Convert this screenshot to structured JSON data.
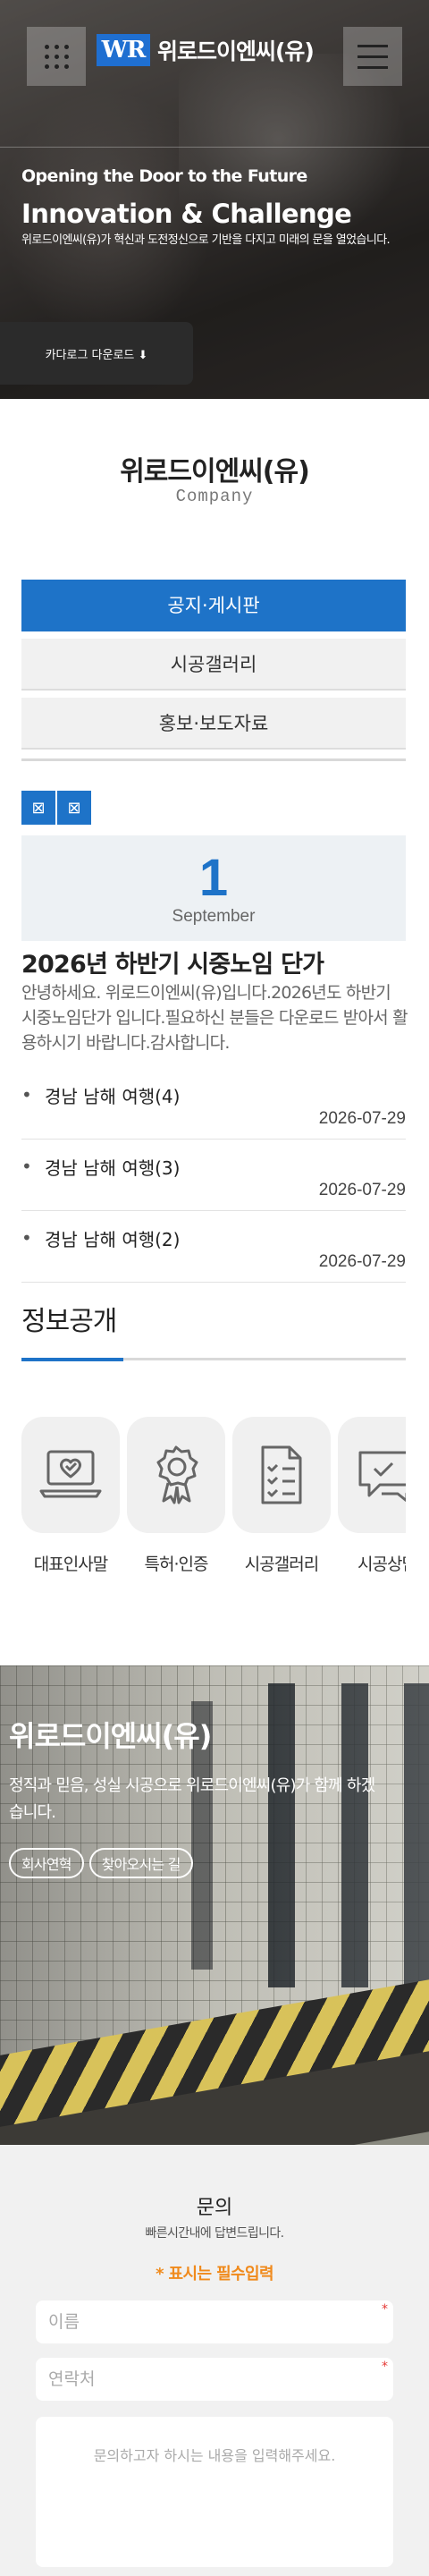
{
  "header": {
    "logo_mark": "WR",
    "logo_text": "위로드이엔씨(유)",
    "grid_icon": "grid-dots-icon",
    "menu_icon": "hamburger-menu-icon"
  },
  "hero": {
    "subtitle": "Opening the Door to the Future",
    "title": "Innovation & Challenge",
    "description": "위로드이엔씨(유)가 혁신과 도전정신으로 기반을 다지고 미래의 문을 열었습니다.",
    "catalog_button": "카다로그 다운로드 ⬇"
  },
  "company": {
    "title": "위로드이엔씨(유)",
    "subtitle": "Company"
  },
  "tabs": [
    {
      "label": "공지·게시판",
      "active": true
    },
    {
      "label": "시공갤러리",
      "active": false
    },
    {
      "label": "홍보·보도자료",
      "active": false
    }
  ],
  "pager": {
    "prev": "⊠",
    "next": "⊠"
  },
  "featured_post": {
    "day": "1",
    "month": "September",
    "title": "2026년 하반기 시중노임 단가",
    "body": "안녕하세요. 위로드이엔씨(유)입니다.2026년도 하반기 시중노임단가 입니다.필요하신 분들은 다운로드 받아서 활용하시기 바랍니다.감사합니다."
  },
  "news": [
    {
      "bullet": "•",
      "title": "경남 남해 여행(4)",
      "date": "2026-07-29"
    },
    {
      "bullet": "•",
      "title": "경남 남해 여행(3)",
      "date": "2026-07-29"
    },
    {
      "bullet": "•",
      "title": "경남 남해 여행(2)",
      "date": "2026-07-29"
    }
  ],
  "info": {
    "title": "정보공개",
    "items": [
      {
        "label": "대표인사말",
        "icon": "laptop-heart-icon"
      },
      {
        "label": "특허·인증",
        "icon": "award-badge-icon"
      },
      {
        "label": "시공갤러리",
        "icon": "checklist-icon"
      },
      {
        "label": "시공상담",
        "icon": "chat-check-icon"
      }
    ]
  },
  "promo": {
    "title": "위로드이엔씨(유)",
    "description": "정직과 믿음, 성실 시공으로 위로드이엔씨(유)가 함께 하겠습니다.",
    "buttons": [
      "회사연혁",
      "찾아오시는 길"
    ]
  },
  "contact": {
    "title": "문의",
    "subtitle": "빠른시간내에 답변드립니다.",
    "required_note": "* 표시는 필수입력",
    "name_placeholder": "이름",
    "phone_placeholder": "연락처",
    "message_placeholder": "문의하고자 하시는 내용을 입력해주세요.",
    "required_mark": "*"
  },
  "colors": {
    "accent": "#1e73c8",
    "required": "#f08a1c",
    "dark_button": "#2b2b2b"
  }
}
